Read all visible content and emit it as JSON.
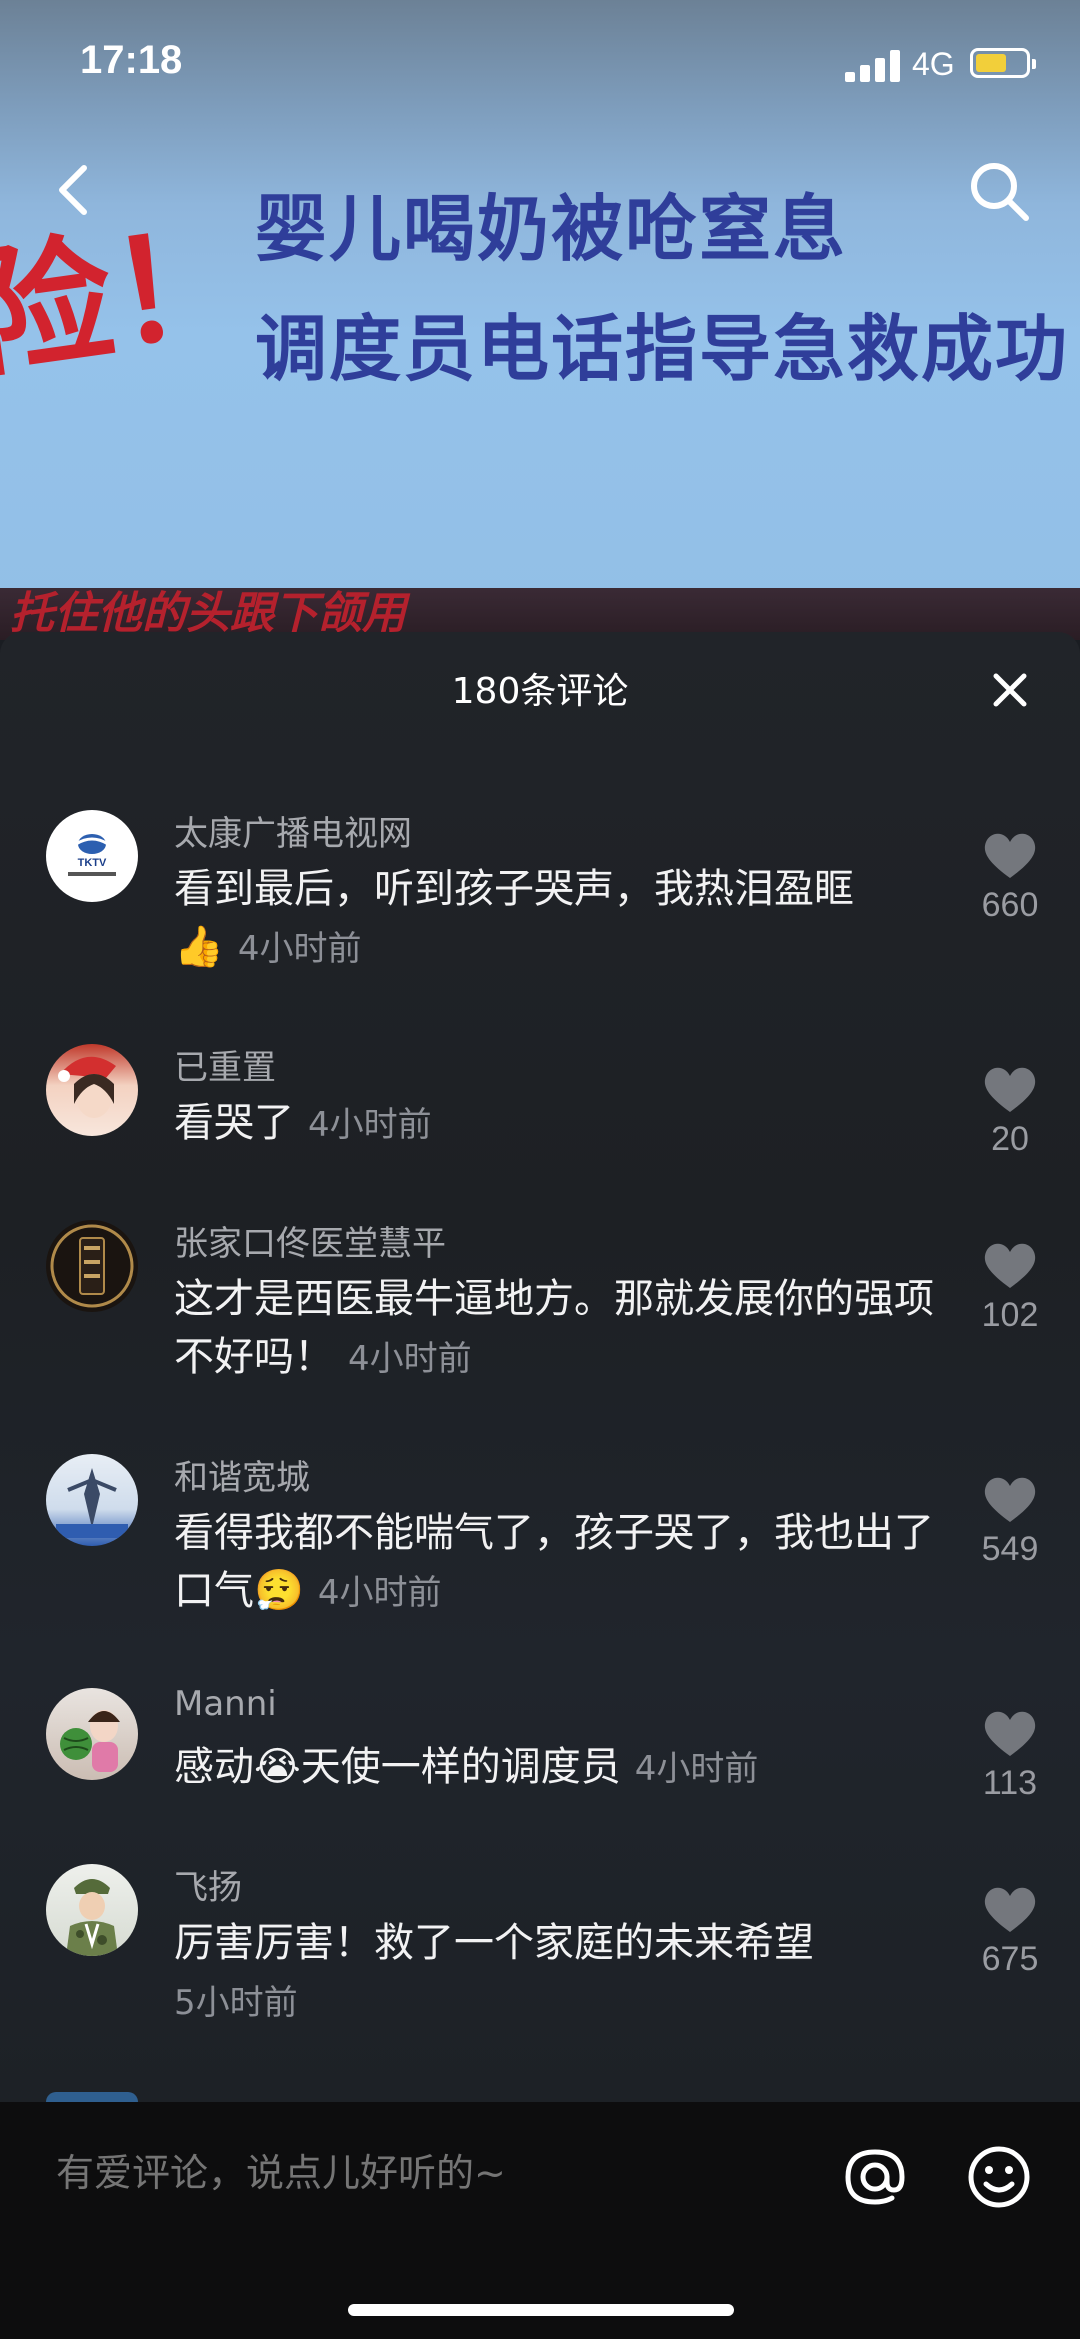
{
  "status_bar": {
    "time": "17:18",
    "network": "4G"
  },
  "video": {
    "headline_line1": "婴儿喝奶被呛窒息",
    "headline_line2": "调度员电话指导急救成功",
    "side_text": "险！",
    "bottom_strip_text": "托住他的头跟下颌用"
  },
  "comments_panel": {
    "title": "180条评论",
    "items": [
      {
        "username": "太康广播电视网",
        "text": "看到最后，听到孩子哭声，我热泪盈眶",
        "emoji": "👍",
        "time": "4小时前",
        "likes": "660"
      },
      {
        "username": "已重置",
        "text": "看哭了",
        "emoji": "",
        "time": "4小时前",
        "likes": "20"
      },
      {
        "username": "张家口佟医堂慧平",
        "text": "这才是西医最牛逼地方。那就发展你的强项不好吗！",
        "emoji": "",
        "time": "4小时前",
        "likes": "102"
      },
      {
        "username": "和谐宽城",
        "text": "看得我都不能喘气了，孩子哭了，我也出了口气",
        "emoji": "😮‍💨",
        "time": "4小时前",
        "likes": "549"
      },
      {
        "username": "Manni",
        "text": "感动",
        "emoji": "😭",
        "text2": "天使一样的调度员",
        "time": "4小时前",
        "likes": "113"
      },
      {
        "username": "飞扬",
        "text": "厉害厉害！救了一个家庭的未来希望",
        "emoji": "",
        "time": "5小时前",
        "likes": "675"
      }
    ]
  },
  "bottom_bar": {
    "input_placeholder": "有爱评论，说点儿好听的~"
  },
  "colors": {
    "sheet_bg": "#1d2024",
    "video_headline": "#2f3e9a",
    "video_red": "#d2232e",
    "battery_fill": "#f2cf3a"
  }
}
